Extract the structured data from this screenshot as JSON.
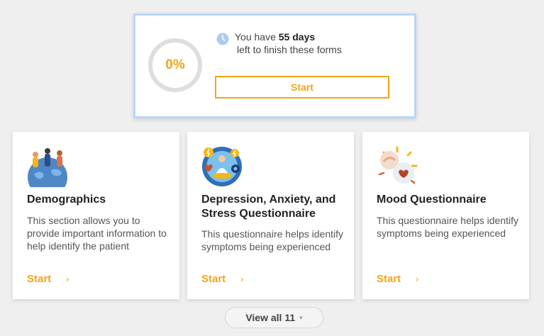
{
  "progress": {
    "percent_label": "0%",
    "percent_value": 0,
    "days_prefix": "You have",
    "days_value": "55 days",
    "days_suffix": "left to finish these forms",
    "start_label": "Start",
    "icon": "clock-icon"
  },
  "cards": [
    {
      "title": "Demographics",
      "description": "This section allows you to provide important information to help identify the patient",
      "start_label": "Start",
      "chevron": "›",
      "icon": "globe-people-icon"
    },
    {
      "title": "Depression, Anxiety, and Stress Questionnaire",
      "description": "This questionnaire helps identify symptoms being experienced",
      "start_label": "Start",
      "chevron": "›",
      "icon": "meditation-icon"
    },
    {
      "title": "Mood Questionnaire",
      "description": "This questionnaire helps identify symptoms being experienced",
      "start_label": "Start",
      "chevron": "›",
      "icon": "heart-hands-icon"
    }
  ],
  "view_all": {
    "label": "View all 11",
    "caret": "▾"
  },
  "colors": {
    "accent": "#f2a516",
    "card_border": "#b9d7f7",
    "background": "#efefef"
  }
}
